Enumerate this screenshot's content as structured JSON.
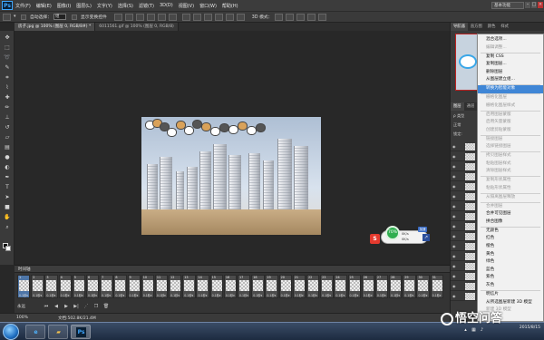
{
  "app": {
    "logo": "Ps"
  },
  "menubar": {
    "items": [
      "文件(F)",
      "编辑(E)",
      "图像(I)",
      "图层(L)",
      "文字(Y)",
      "选择(S)",
      "滤镜(T)",
      "3D(D)",
      "视图(V)",
      "窗口(W)",
      "帮助(H)"
    ],
    "workspace": "基本功能"
  },
  "optionsbar": {
    "auto_select": "自动选择：",
    "auto_select_value": "组",
    "transform": "显示变换控件",
    "mode_3d": "3D 模式："
  },
  "doc_tabs": [
    {
      "label": "房子.jpg @ 100% (图层 0, RGB/8#) *",
      "active": true
    },
    {
      "label": "6011561.gif @ 100% (图层 0, RGB/8)",
      "active": false
    }
  ],
  "tools": [
    "move-icon",
    "marquee-icon",
    "lasso-icon",
    "quick-select-icon",
    "crop-icon",
    "eyedropper-icon",
    "heal-icon",
    "brush-icon",
    "stamp-icon",
    "history-brush-icon",
    "eraser-icon",
    "gradient-icon",
    "blur-icon",
    "dodge-icon",
    "pen-icon",
    "text-icon",
    "path-select-icon",
    "shape-icon",
    "hand-icon",
    "zoom-icon"
  ],
  "widget": {
    "brand": "S",
    "gauge": "70%",
    "speed_up": "0K/s",
    "speed_down": "0K/s",
    "badge": "加速",
    "toggle": "↗"
  },
  "timeline": {
    "title": "时间轴",
    "frames": [
      {
        "n": "1",
        "d": "0.1秒▾"
      },
      {
        "n": "2",
        "d": "0.1秒▾"
      },
      {
        "n": "3",
        "d": "0.1秒▾"
      },
      {
        "n": "4",
        "d": "0.1秒▾"
      },
      {
        "n": "5",
        "d": "0.1秒▾"
      },
      {
        "n": "6",
        "d": "0.1秒▾"
      },
      {
        "n": "7",
        "d": "0.1秒▾"
      },
      {
        "n": "8",
        "d": "0.1秒▾"
      },
      {
        "n": "9",
        "d": "0.1秒▾"
      },
      {
        "n": "10",
        "d": "0.1秒▾"
      },
      {
        "n": "11",
        "d": "0.1秒▾"
      },
      {
        "n": "12",
        "d": "0.1秒▾"
      },
      {
        "n": "13",
        "d": "0.1秒▾"
      },
      {
        "n": "14",
        "d": "0.1秒▾"
      },
      {
        "n": "15",
        "d": "0.1秒▾"
      },
      {
        "n": "16",
        "d": "0.1秒▾"
      },
      {
        "n": "17",
        "d": "0.1秒▾"
      },
      {
        "n": "18",
        "d": "0.1秒▾"
      },
      {
        "n": "19",
        "d": "0.1秒▾"
      },
      {
        "n": "20",
        "d": "0.1秒▾"
      },
      {
        "n": "21",
        "d": "0.1秒▾"
      },
      {
        "n": "22",
        "d": "0.1秒▾"
      },
      {
        "n": "23",
        "d": "0.1秒▾"
      },
      {
        "n": "24",
        "d": "0.1秒▾"
      },
      {
        "n": "25",
        "d": "0.1秒▾"
      },
      {
        "n": "26",
        "d": "0.1秒▾"
      },
      {
        "n": "27",
        "d": "0.1秒▾"
      },
      {
        "n": "28",
        "d": "0.1秒▾"
      },
      {
        "n": "29",
        "d": "0.1秒▾"
      },
      {
        "n": "30",
        "d": "0.1秒▾"
      },
      {
        "n": "31",
        "d": "0.1秒▾"
      }
    ],
    "loop": "永远"
  },
  "status": {
    "zoom": "100%",
    "doc": "文档:502.8K/21.4M"
  },
  "panels": {
    "top_tabs": [
      "导航器",
      "直方图",
      "颜色",
      "样式"
    ],
    "layer_tabs": [
      "图层",
      "通道",
      "路径"
    ],
    "layer_kind": "ρ 类型",
    "blend": "正常",
    "lock": "锁定:"
  },
  "context_menu": {
    "items": [
      {
        "label": "混合选项...",
        "state": "normal"
      },
      {
        "label": "编辑调整...",
        "state": "disabled"
      },
      {
        "label": "复制 CSS",
        "state": "normal"
      },
      {
        "label": "复制图层...",
        "state": "normal"
      },
      {
        "label": "删除图层",
        "state": "normal"
      },
      {
        "label": "从图层建立组...",
        "state": "normal"
      },
      {
        "label": "转换为智能对象",
        "state": "highlight"
      },
      {
        "label": "栅格化图层",
        "state": "disabled"
      },
      {
        "label": "栅格化图层样式",
        "state": "disabled"
      },
      {
        "label": "启用图层蒙版",
        "state": "disabled"
      },
      {
        "label": "启用矢量蒙版",
        "state": "disabled"
      },
      {
        "label": "创建剪贴蒙版",
        "state": "disabled"
      },
      {
        "label": "链接图层",
        "state": "disabled"
      },
      {
        "label": "选择链接图层",
        "state": "disabled"
      },
      {
        "label": "拷贝图层样式",
        "state": "disabled"
      },
      {
        "label": "粘贴图层样式",
        "state": "disabled"
      },
      {
        "label": "清除图层样式",
        "state": "disabled"
      },
      {
        "label": "复制形状属性",
        "state": "disabled"
      },
      {
        "label": "粘贴形状属性",
        "state": "disabled"
      },
      {
        "label": "从隔离图层释放",
        "state": "disabled"
      },
      {
        "label": "合并图层",
        "state": "disabled"
      },
      {
        "label": "合并可见图层",
        "state": "normal"
      },
      {
        "label": "拼合图像",
        "state": "normal"
      },
      {
        "label": "无颜色",
        "state": "normal"
      },
      {
        "label": "红色",
        "state": "normal"
      },
      {
        "label": "橙色",
        "state": "normal"
      },
      {
        "label": "黄色",
        "state": "normal"
      },
      {
        "label": "绿色",
        "state": "normal"
      },
      {
        "label": "蓝色",
        "state": "normal"
      },
      {
        "label": "紫色",
        "state": "normal"
      },
      {
        "label": "灰色",
        "state": "normal"
      },
      {
        "label": "明信片",
        "state": "normal"
      },
      {
        "label": "从所选图层新建 3D 模型",
        "state": "normal"
      },
      {
        "label": "新建 3D 模型",
        "state": "disabled"
      }
    ]
  },
  "taskbar": {
    "time": "2015/8/15",
    "clock": "",
    "apps": [
      "ie-icon",
      "folder-icon",
      "photoshop-icon"
    ]
  },
  "watermark": "悟空问答",
  "colors": {
    "accent": "#3f86d6",
    "bg": "#282828",
    "panel": "#3a3a3a"
  }
}
